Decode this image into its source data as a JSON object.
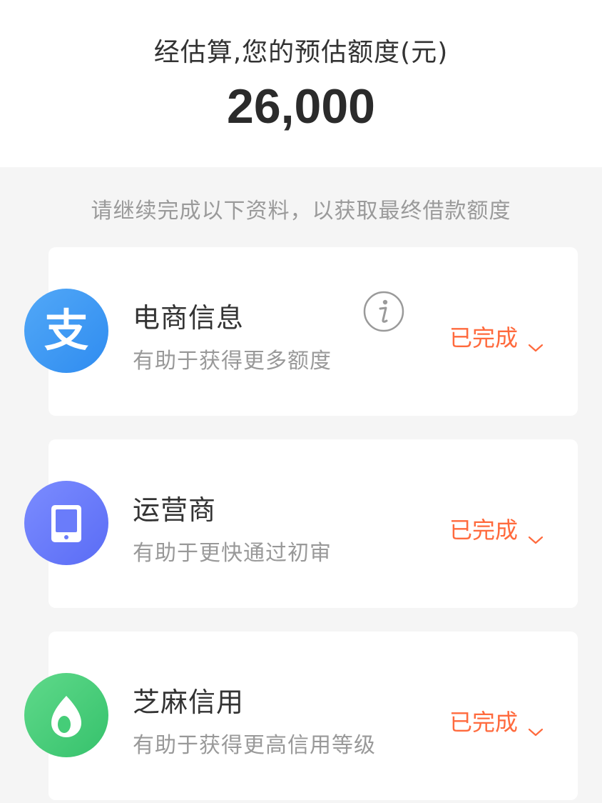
{
  "header": {
    "title": "经估算,您的预估额度(元)",
    "amount": "26,000"
  },
  "hint": "请继续完成以下资料，以获取最终借款额度",
  "colors": {
    "status": "#ff6a3d",
    "alipay": "#3c9af4",
    "carrier": "#6a7cfa",
    "sesame": "#45cd78"
  },
  "items": [
    {
      "icon": "alipay-icon",
      "title": "电商信息",
      "subtitle": "有助于获得更多额度",
      "status": "已完成",
      "has_info": true
    },
    {
      "icon": "phone-icon",
      "title": "运营商",
      "subtitle": "有助于更快通过初审",
      "status": "已完成",
      "has_info": false
    },
    {
      "icon": "sesame-icon",
      "title": "芝麻信用",
      "subtitle": "有助于获得更高信用等级",
      "status": "已完成",
      "has_info": false
    }
  ]
}
